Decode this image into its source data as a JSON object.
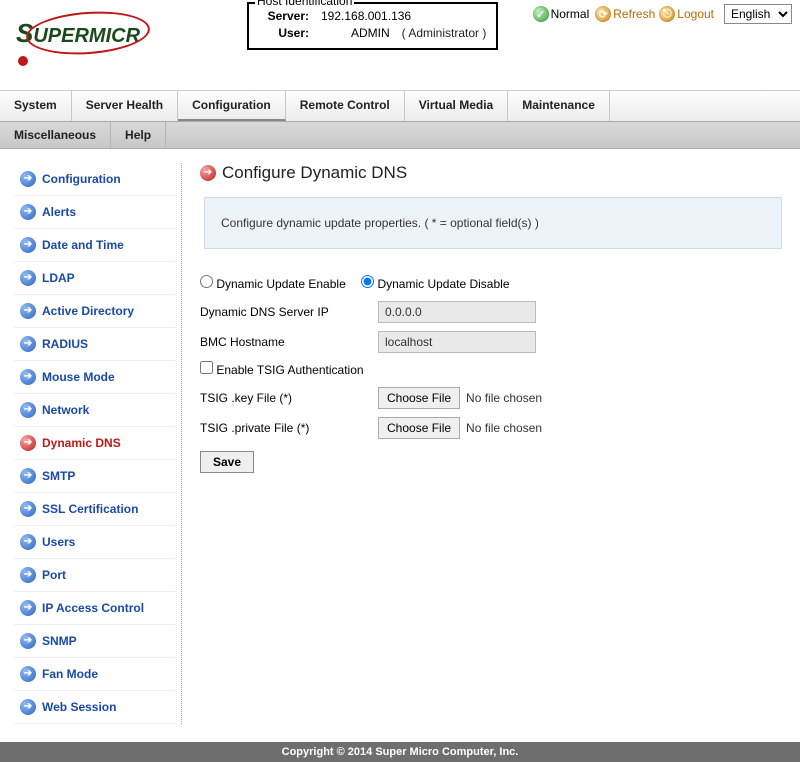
{
  "hostIdentification": {
    "legend": "Host Identification",
    "serverLabel": "Server:",
    "server": "192.168.001.136",
    "userLabel": "User:",
    "user": "ADMIN",
    "role": "( Administrator )"
  },
  "topRight": {
    "normal": "Normal",
    "refresh": "Refresh",
    "logout": "Logout",
    "language": "English"
  },
  "logo": {
    "brandS": "S",
    "brandRest": "UPERMICR"
  },
  "menu1": [
    "System",
    "Server Health",
    "Configuration",
    "Remote Control",
    "Virtual Media",
    "Maintenance"
  ],
  "menu2": [
    "Miscellaneous",
    "Help"
  ],
  "sidebar": [
    {
      "label": "Configuration",
      "active": false
    },
    {
      "label": "Alerts",
      "active": false
    },
    {
      "label": "Date and Time",
      "active": false
    },
    {
      "label": "LDAP",
      "active": false
    },
    {
      "label": "Active Directory",
      "active": false
    },
    {
      "label": "RADIUS",
      "active": false
    },
    {
      "label": "Mouse Mode",
      "active": false
    },
    {
      "label": "Network",
      "active": false
    },
    {
      "label": "Dynamic DNS",
      "active": true
    },
    {
      "label": "SMTP",
      "active": false
    },
    {
      "label": "SSL Certification",
      "active": false
    },
    {
      "label": "Users",
      "active": false
    },
    {
      "label": "Port",
      "active": false
    },
    {
      "label": "IP Access Control",
      "active": false
    },
    {
      "label": "SNMP",
      "active": false
    },
    {
      "label": "Fan Mode",
      "active": false
    },
    {
      "label": "Web Session",
      "active": false
    }
  ],
  "page": {
    "title": "Configure Dynamic DNS",
    "infoBox": "Configure dynamic update properties. ( * = optional field(s) )",
    "radioEnable": "Dynamic Update Enable",
    "radioDisable": "Dynamic Update Disable",
    "dnsServerLabel": "Dynamic DNS Server IP",
    "dnsServerValue": "0.0.0.0",
    "bmcHostLabel": "BMC Hostname",
    "bmcHostValue": "localhost",
    "tsigCheckbox": "Enable TSIG Authentication",
    "tsigKeyLabel": "TSIG .key File (*)",
    "tsigPrivLabel": "TSIG .private File (*)",
    "chooseFile": "Choose File",
    "noFile": "No file chosen",
    "save": "Save"
  },
  "footer": "Copyright © 2014 Super Micro Computer, Inc."
}
